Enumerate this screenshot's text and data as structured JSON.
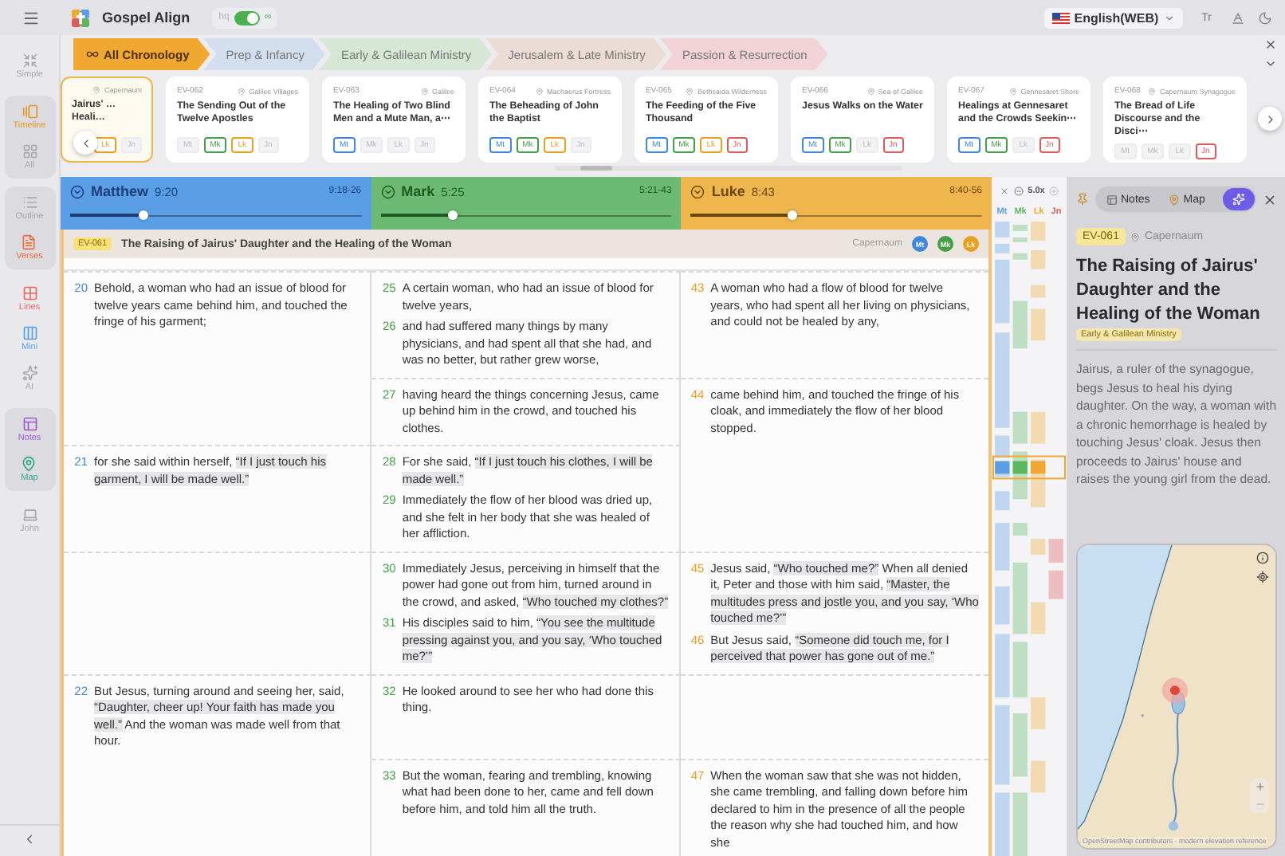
{
  "app": {
    "title": "Gospel Align",
    "toggle": {
      "off_label": "hq",
      "on_label": "∞",
      "on": true
    },
    "language": "English(WEB)",
    "text_size": "Tr"
  },
  "sidebar": [
    {
      "grouped": false,
      "items": [
        {
          "label": "Simple",
          "active": false
        }
      ]
    },
    {
      "grouped": true,
      "items": [
        {
          "label": "Timeline",
          "active": true,
          "color": "#e8961e"
        },
        {
          "label": "All",
          "active": false
        }
      ]
    },
    {
      "grouped": true,
      "items": [
        {
          "label": "Outline",
          "active": false
        },
        {
          "label": "Verses",
          "active": true,
          "color": "#ea6d3a"
        }
      ]
    },
    {
      "grouped": false,
      "items": [
        {
          "label": "Lines",
          "active": true,
          "color": "#e86a6a"
        },
        {
          "label": "Mini",
          "active": true,
          "color": "#5a9ee6"
        },
        {
          "label": "AI",
          "active": false
        }
      ]
    },
    {
      "grouped": true,
      "items": [
        {
          "label": "Notes",
          "active": true,
          "color": "#a05ad0"
        },
        {
          "label": "Map",
          "active": true,
          "color": "#2aa88a"
        }
      ]
    },
    {
      "grouped": false,
      "items": [
        {
          "label": "John",
          "active": false
        }
      ]
    }
  ],
  "categories": [
    {
      "label": "All Chronology",
      "selected": true,
      "color": "#f0a830"
    },
    {
      "label": "Prep & Infancy",
      "selected": false,
      "color": "#d3deee"
    },
    {
      "label": "Early & Galilean Ministry",
      "selected": false,
      "color": "#d6e7d6"
    },
    {
      "label": "Jerusalem & Late Ministry",
      "selected": false,
      "color": "#ecdcd6"
    },
    {
      "label": "Passion & Resurrection",
      "selected": false,
      "color": "#f1d3d8"
    }
  ],
  "events": [
    {
      "location": "Capernaum",
      "title": "Jairus' … Heali…",
      "selected": true,
      "tags": [
        {
          "label": "Lk",
          "on": true,
          "color": "#e8a020"
        },
        {
          "label": "Jn",
          "on": false
        }
      ]
    },
    {
      "id": "EV-062",
      "location": "Galilee Villages",
      "title": "The Sending Out of the Twelve Apostles",
      "selected": false,
      "tags": [
        {
          "label": "Mt",
          "on": false
        },
        {
          "label": "Mk",
          "on": true,
          "color": "#43a047"
        },
        {
          "label": "Lk",
          "on": true,
          "color": "#e8a020"
        },
        {
          "label": "Jn",
          "on": false
        }
      ]
    },
    {
      "id": "EV-063",
      "location": "Galilee",
      "title": "The Healing of Two Blind Men and a Mute Man, a⋯",
      "selected": false,
      "tags": [
        {
          "label": "Mt",
          "on": true,
          "color": "#3f88dd"
        },
        {
          "label": "Mk",
          "on": false
        },
        {
          "label": "Lk",
          "on": false
        },
        {
          "label": "Jn",
          "on": false
        }
      ]
    },
    {
      "id": "EV-064",
      "location": "Machaerus Fortress",
      "title": "The Beheading of John the Baptist",
      "selected": false,
      "tags": [
        {
          "label": "Mt",
          "on": true,
          "color": "#3f88dd"
        },
        {
          "label": "Mk",
          "on": true,
          "color": "#43a047"
        },
        {
          "label": "Lk",
          "on": true,
          "color": "#e8a020"
        },
        {
          "label": "Jn",
          "on": false
        }
      ]
    },
    {
      "id": "EV-065",
      "location": "Bethsaida Wilderness",
      "title": "The Feeding of the Five Thousand",
      "selected": false,
      "tags": [
        {
          "label": "Mt",
          "on": true,
          "color": "#3f88dd"
        },
        {
          "label": "Mk",
          "on": true,
          "color": "#43a047"
        },
        {
          "label": "Lk",
          "on": true,
          "color": "#e8a020"
        },
        {
          "label": "Jn",
          "on": true,
          "color": "#e05a5a"
        }
      ]
    },
    {
      "id": "EV-066",
      "location": "Sea of Galilee",
      "title": "Jesus Walks on the Water",
      "selected": false,
      "tags": [
        {
          "label": "Mt",
          "on": true,
          "color": "#3f88dd"
        },
        {
          "label": "Mk",
          "on": true,
          "color": "#43a047"
        },
        {
          "label": "Lk",
          "on": false
        },
        {
          "label": "Jn",
          "on": true,
          "color": "#e05a5a"
        }
      ]
    },
    {
      "id": "EV-067",
      "location": "Gennesaret Shore",
      "title": "Healings at Gennesaret and the Crowds Seekin⋯",
      "selected": false,
      "tags": [
        {
          "label": "Mt",
          "on": true,
          "color": "#3f88dd"
        },
        {
          "label": "Mk",
          "on": true,
          "color": "#43a047"
        },
        {
          "label": "Lk",
          "on": false
        },
        {
          "label": "Jn",
          "on": true,
          "color": "#e05a5a"
        }
      ]
    },
    {
      "id": "EV-068",
      "location": "Capernaum Synagogue",
      "title": "The Bread of Life Discourse and the Disci⋯",
      "selected": false,
      "tags": [
        {
          "label": "Mt",
          "on": false
        },
        {
          "label": "Mk",
          "on": false
        },
        {
          "label": "Lk",
          "on": false
        },
        {
          "label": "Jn",
          "on": true,
          "color": "#e05a5a"
        }
      ]
    }
  ],
  "gospels": [
    {
      "name": "Matthew",
      "ref": "9:20",
      "range": "9:18-26",
      "level": 0.25,
      "color": "#5a9fe6"
    },
    {
      "name": "Mark",
      "ref": "5:25",
      "range": "5:21-43",
      "level": 0.25,
      "color": "#6dbb72"
    },
    {
      "name": "Luke",
      "ref": "8:43",
      "range": "8:40-56",
      "level": 0.35,
      "color": "#f0b64e"
    }
  ],
  "event": {
    "id": "EV-061",
    "title": "The Raising of Jairus' Daughter and the Healing of the Woman",
    "location": "Capernaum",
    "gospels": [
      {
        "label": "Mt",
        "color": "#3f88dd"
      },
      {
        "label": "Mk",
        "color": "#43a047"
      },
      {
        "label": "Lk",
        "color": "#e8a020"
      }
    ]
  },
  "rows": [
    {
      "cells": [
        {
          "joined": false,
          "verses": [
            {
              "num": "20",
              "parts": [
                {
                  "kind": "plain",
                  "text": "Behold, a woman who had an issue of blood for twelve years came behind him, and touched the fringe of his garment;"
                }
              ]
            }
          ]
        },
        {
          "joined": false,
          "verses": [
            {
              "num": "25",
              "parts": [
                {
                  "kind": "plain",
                  "text": "A certain woman, who had an issue of blood for twelve years,"
                }
              ]
            },
            {
              "num": "26",
              "parts": [
                {
                  "kind": "plain",
                  "text": "and had suffered many things by many physicians, and had spent all that she had, and was no better, but rather grew worse,"
                }
              ]
            }
          ]
        },
        {
          "joined": false,
          "verses": [
            {
              "num": "43",
              "parts": [
                {
                  "kind": "plain",
                  "text": "A woman who had a flow of blood for twelve years, who had spent all her living on physicians, and could not be healed by any,"
                }
              ]
            }
          ]
        }
      ]
    },
    {
      "cells": [
        {
          "joined": true
        },
        {
          "joined": false,
          "verses": [
            {
              "num": "27",
              "parts": [
                {
                  "kind": "plain",
                  "text": "having heard the things concerning Jesus, came up behind him in the crowd, and touched his clothes."
                }
              ]
            }
          ]
        },
        {
          "joined": false,
          "verses": [
            {
              "num": "44",
              "parts": [
                {
                  "kind": "plain",
                  "text": "came behind him, and touched the fringe of his cloak, and immediately the flow of her blood stopped."
                }
              ]
            }
          ]
        }
      ]
    },
    {
      "cells": [
        {
          "joined": false,
          "verses": [
            {
              "num": "21",
              "parts": [
                {
                  "kind": "plain",
                  "text": "for she said within herself, "
                },
                {
                  "kind": "quote",
                  "text": "“If I just touch his garment, I will be made well.”"
                }
              ]
            }
          ]
        },
        {
          "joined": false,
          "verses": [
            {
              "num": "28",
              "parts": [
                {
                  "kind": "plain",
                  "text": "For she said, "
                },
                {
                  "kind": "quote",
                  "text": "“If I just touch his clothes, I will be made well.”"
                }
              ]
            },
            {
              "num": "29",
              "parts": [
                {
                  "kind": "plain",
                  "text": "Immediately the flow of her blood was dried up, and she felt in her body that she was healed of her affliction."
                }
              ]
            }
          ]
        },
        {
          "joined": true
        }
      ]
    },
    {
      "cells": [
        {
          "joined": false
        },
        {
          "joined": false,
          "verses": [
            {
              "num": "30",
              "parts": [
                {
                  "kind": "plain",
                  "text": "Immediately Jesus, perceiving in himself that the power had gone out from him, turned around in the crowd, and asked, "
                },
                {
                  "kind": "quote",
                  "text": "“Who touched my clothes?”"
                }
              ]
            },
            {
              "num": "31",
              "parts": [
                {
                  "kind": "plain",
                  "text": "His disciples said to him, "
                },
                {
                  "kind": "quote",
                  "text": "“You see the multitude pressing against you, and you say, ‘Who touched me?’”"
                }
              ]
            }
          ]
        },
        {
          "joined": false,
          "verses": [
            {
              "num": "45",
              "parts": [
                {
                  "kind": "plain",
                  "text": "Jesus said, "
                },
                {
                  "kind": "quote",
                  "text": "“Who touched me?”"
                },
                {
                  "kind": "plain",
                  "text": " When all denied it, Peter and those with him said, "
                },
                {
                  "kind": "quote",
                  "text": "“Master, the multitudes press and jostle you, and you say, ‘Who touched me?’”"
                }
              ]
            },
            {
              "num": "46",
              "parts": [
                {
                  "kind": "plain",
                  "text": "But Jesus said, "
                },
                {
                  "kind": "quote",
                  "text": "“Someone did touch me, for I perceived that power has gone out of me.”"
                }
              ]
            }
          ]
        }
      ]
    },
    {
      "cells": [
        {
          "joined": false,
          "verses": [
            {
              "num": "22",
              "parts": [
                {
                  "kind": "plain",
                  "text": "But Jesus, turning around and seeing her, said, "
                },
                {
                  "kind": "quote",
                  "text": "“Daughter, cheer up! Your faith has made you well.”"
                },
                {
                  "kind": "plain",
                  "text": " And the woman was made well from that hour."
                }
              ]
            }
          ]
        },
        {
          "joined": false,
          "verses": [
            {
              "num": "32",
              "parts": [
                {
                  "kind": "plain",
                  "text": "He looked around to see her who had done this thing."
                }
              ]
            }
          ]
        },
        {
          "joined": false
        }
      ]
    },
    {
      "cells": [
        {
          "joined": true
        },
        {
          "joined": false,
          "verses": [
            {
              "num": "33",
              "parts": [
                {
                  "kind": "plain",
                  "text": "But the woman, fearing and trembling, knowing what had been done to her, came and fell down before him, and told him all the truth."
                }
              ]
            }
          ]
        },
        {
          "joined": false,
          "verses": [
            {
              "num": "47",
              "parts": [
                {
                  "kind": "plain",
                  "text": "When the woman saw that she was not hidden, she came trembling, and falling down before him declared to him in the presence of all the people the reason why she had touched him, and how she"
                }
              ]
            }
          ]
        }
      ]
    }
  ],
  "minimap": {
    "zoom": "5.0x",
    "columns": [
      {
        "label": "Mt",
        "color": "#5a9ee6"
      },
      {
        "label": "Mk",
        "color": "#5cb860"
      },
      {
        "label": "Lk",
        "color": "#f0a830"
      },
      {
        "label": "Jn",
        "color": "#e05a5a"
      }
    ]
  },
  "panel": {
    "tabs": [
      {
        "label": "Notes",
        "selected": false
      },
      {
        "label": "Map",
        "selected": false
      }
    ],
    "ai_active": true,
    "event": {
      "id": "EV-061",
      "location": "Capernaum",
      "title": "The Raising of Jairus' Daughter and the Healing of the Woman",
      "era": "Early & Galilean Ministry",
      "description": "Jairus, a ruler of the synagogue, begs Jesus to heal his dying daughter. On the way, a woman with a chronic hemorrhage is healed by touching Jesus' cloak. Jesus then proceeds to Jairus' house and raises the young girl from the dead."
    },
    "map": {
      "attribution": "OpenStreetMap contributors · modern elevation reference"
    }
  }
}
